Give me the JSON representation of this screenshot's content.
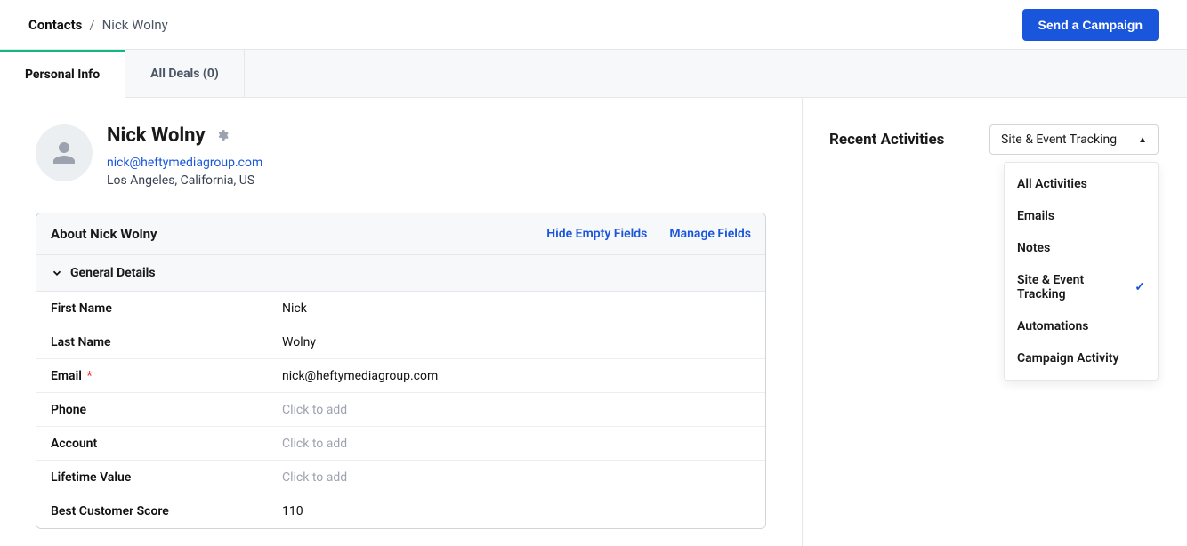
{
  "header": {
    "breadcrumb_root": "Contacts",
    "breadcrumb_sep": "/",
    "breadcrumb_leaf": "Nick Wolny",
    "send_campaign_label": "Send a Campaign"
  },
  "tabs": [
    {
      "label": "Personal Info",
      "active": true
    },
    {
      "label": "All Deals (0)",
      "active": false
    }
  ],
  "profile": {
    "name": "Nick Wolny",
    "email": "nick@heftymediagroup.com",
    "location": "Los Angeles, California, US"
  },
  "about": {
    "title": "About Nick Wolny",
    "hide_empty_label": "Hide Empty Fields",
    "manage_fields_label": "Manage Fields",
    "section_label": "General Details",
    "fields": [
      {
        "label": "First Name",
        "value": "Nick",
        "required": false,
        "placeholder": false
      },
      {
        "label": "Last Name",
        "value": "Wolny",
        "required": false,
        "placeholder": false
      },
      {
        "label": "Email",
        "value": "nick@heftymediagroup.com",
        "required": true,
        "placeholder": false
      },
      {
        "label": "Phone",
        "value": "Click to add",
        "required": false,
        "placeholder": true
      },
      {
        "label": "Account",
        "value": "Click to add",
        "required": false,
        "placeholder": true
      },
      {
        "label": "Lifetime Value",
        "value": "Click to add",
        "required": false,
        "placeholder": true
      },
      {
        "label": "Best Customer Score",
        "value": "110",
        "required": false,
        "placeholder": false
      }
    ]
  },
  "right": {
    "title": "Recent Activities",
    "selected_filter": "Site & Event Tracking",
    "dropdown_options": [
      {
        "label": "All Activities",
        "selected": false
      },
      {
        "label": "Emails",
        "selected": false
      },
      {
        "label": "Notes",
        "selected": false
      },
      {
        "label": "Site & Event Tracking",
        "selected": true
      },
      {
        "label": "Automations",
        "selected": false
      },
      {
        "label": "Campaign Activity",
        "selected": false
      }
    ]
  }
}
